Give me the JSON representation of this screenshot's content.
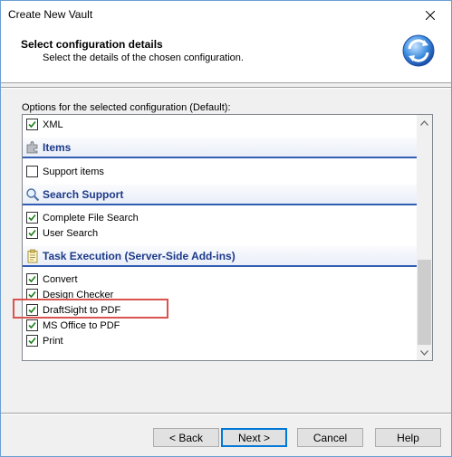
{
  "window": {
    "title": "Create New Vault"
  },
  "header": {
    "title": "Select configuration details",
    "subtitle": "Select the details of the chosen configuration."
  },
  "options_label": "Options for the selected configuration (Default):",
  "list": {
    "rows": [
      {
        "type": "item",
        "label": "XML",
        "checked": true
      },
      {
        "type": "group",
        "label": "Items",
        "icon": "puzzle-icon"
      },
      {
        "type": "item",
        "label": "Support items",
        "checked": false
      },
      {
        "type": "group",
        "label": "Search Support",
        "icon": "magnifier-icon"
      },
      {
        "type": "item",
        "label": "Complete File Search",
        "checked": true
      },
      {
        "type": "item",
        "label": "User Search",
        "checked": true
      },
      {
        "type": "group",
        "label": "Task Execution (Server-Side Add-ins)",
        "icon": "clipboard-icon"
      },
      {
        "type": "item",
        "label": "Convert",
        "checked": true
      },
      {
        "type": "item",
        "label": "Design Checker",
        "checked": true
      },
      {
        "type": "item",
        "label": "DraftSight to PDF",
        "checked": true
      },
      {
        "type": "item",
        "label": "MS Office to PDF",
        "checked": true
      },
      {
        "type": "item",
        "label": "Print",
        "checked": true
      }
    ]
  },
  "buttons": {
    "back": "< Back",
    "next": "Next >",
    "cancel": "Cancel",
    "help": "Help"
  },
  "colors": {
    "highlight": "#d9534f",
    "group_text": "#1d3a8a",
    "group_border": "#2f5eb3"
  }
}
